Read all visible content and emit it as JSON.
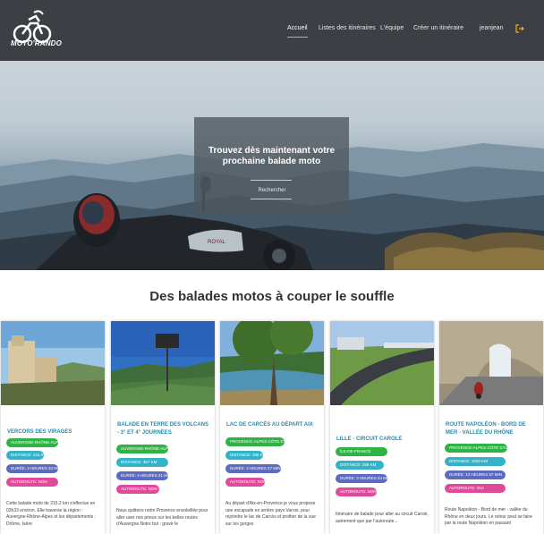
{
  "header": {
    "logo_text": "MOTO'RANDO",
    "nav": [
      {
        "label": "Accueil",
        "active": true
      },
      {
        "label": "Listes des itinéraires",
        "active": false
      },
      {
        "label": "L'équipe",
        "active": false
      },
      {
        "label": "Créer un itinéraire",
        "active": false
      },
      {
        "label": "jeanjean",
        "active": false
      }
    ],
    "accent_color": "#f5a623",
    "logout_icon": "logout-icon"
  },
  "hero": {
    "title": "Trouvez dès maintenant votre prochaine balade moto",
    "button": "Rechercher"
  },
  "section": {
    "title": "Des balades motos à couper le souffle"
  },
  "cards": [
    {
      "title": "VERCORS DES VIRAGES",
      "tags": [
        "AUVERGNE-RHÔNE-ALPES",
        "DISTANCE: 215 KM",
        "DURÉE: 3 HEURES 33 MIN",
        "AUTOROUTE: NON"
      ],
      "description": "Cette balade moto de 215.2 km s'effectue en 03h33 environ. Elle traverse la région : Auvergne-Rhône-Alpes et les départements : Drôme, Isère"
    },
    {
      "title": "BALADE EN TERRE DES VOLCANS - 3° ET 4° JOURNÉES",
      "tags": [
        "AUVERGNE-RHÔNE-ALPES",
        "DISTANCE: 367 KM",
        "DURÉE: 4 HEURES 21 MIN",
        "AUTOROUTE: NON"
      ],
      "description": "Nous quittons notre Provence ensoleillée pour aller user nos pneus sur les belles routes d'Auvergne.Notre but : gravir le"
    },
    {
      "title": "LAC DE CARCÈS AU DÉPART AIX",
      "tags": [
        "PROVENCE-ALPES-CÔTE D'AZUR",
        "DISTANCE: 198 KM",
        "DURÉE: 3 HEURES 27 MIN",
        "AUTOROUTE: NON"
      ],
      "description": "Au départ d'Aix-en-Provence je vous propose une escapade en arrière pays Varois, pour rejoindre le lac de Carcès et profiter de la vue sur les gorges"
    },
    {
      "title": "LILLE - CIRCUIT CAROLE",
      "tags": [
        "ÎLE-DE-FRANCE",
        "DISTANCE: 258 KM",
        "DURÉE: 3 HEURES 24 MIN",
        "AUTOROUTE: NON"
      ],
      "description": "Itinéraire de balade pour aller au circuit Carole, autrement que par l'autoroute..."
    },
    {
      "title": "ROUTE NAPOLÉON - BORD DE MER - VALLÉE DU RHÔNE",
      "tags": [
        "PROVENCE-ALPES-CÔTE D'AZUR",
        "DISTANCE: 1000 KM",
        "DURÉE: 13 HEURES 57 MIN",
        "AUTOROUTE: OUI"
      ],
      "description": "Route Napoléon - Bord de mer - vallée du Rhône en deux jours. Le retour peut se faire par la route Napoléon en passant"
    }
  ]
}
